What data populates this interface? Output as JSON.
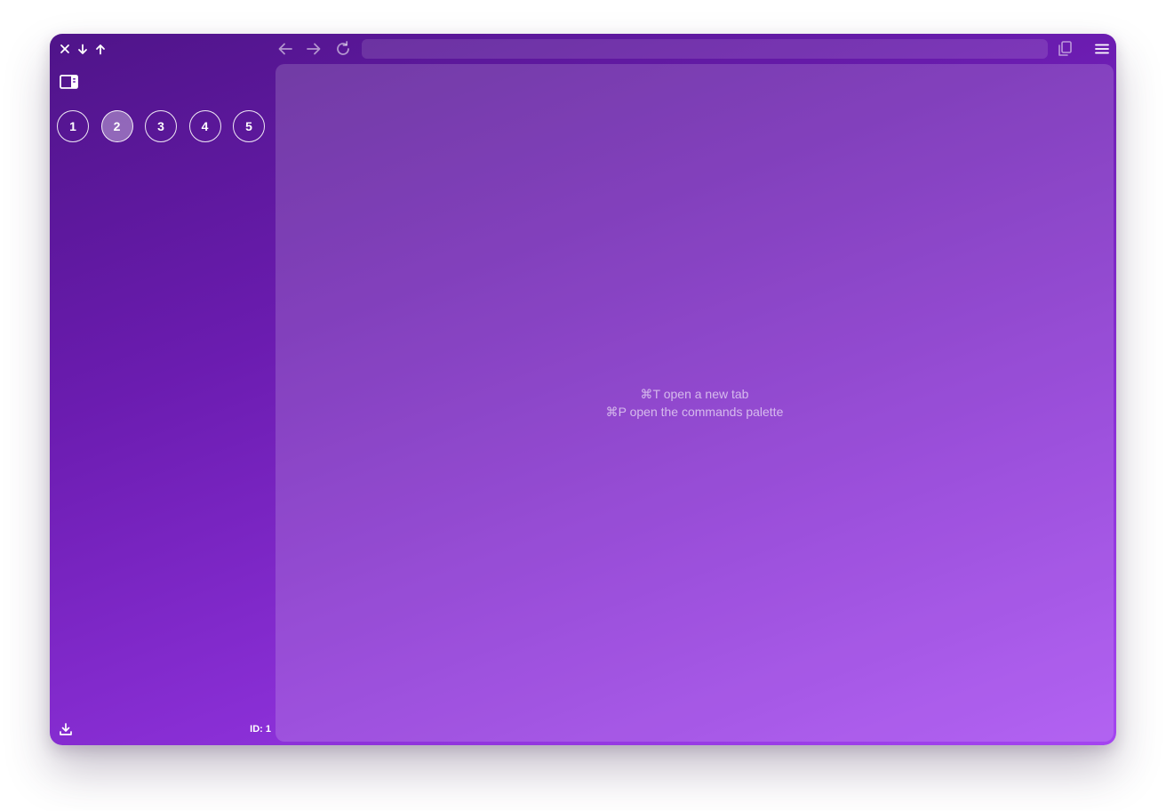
{
  "window": {
    "id_label": "ID: 1"
  },
  "titlebar": {
    "controls": [
      "close-icon",
      "arrow-down-icon",
      "arrow-up-icon"
    ]
  },
  "sidebar": {
    "spaces": [
      {
        "label": "1",
        "active": false
      },
      {
        "label": "2",
        "active": true
      },
      {
        "label": "3",
        "active": false
      },
      {
        "label": "4",
        "active": false
      },
      {
        "label": "5",
        "active": false
      }
    ]
  },
  "toolbar": {
    "url_value": "",
    "icons": [
      "arrow-left-icon",
      "arrow-right-icon",
      "reload-icon",
      "copy-icon",
      "menu-icon"
    ]
  },
  "content": {
    "hint_new_tab": "⌘T open a new tab",
    "hint_commands": "⌘P open the commands palette"
  },
  "colors": {
    "gradient_start": "#4f1489",
    "gradient_end": "#a445f0"
  }
}
